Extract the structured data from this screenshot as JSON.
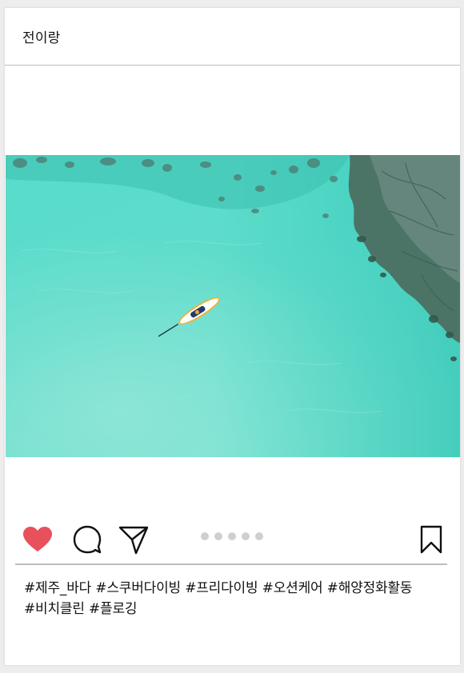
{
  "post": {
    "username": "전이랑",
    "image_alt": "turquoise sea with a paddleboard seen from above",
    "caption_line1": "#제주_바다 #스쿠버다이빙 #프리다이빙 #오션케어 #해양정화활동",
    "caption_line2": "#비치클린 #플로깅",
    "liked": true,
    "carousel": {
      "total": 5
    }
  },
  "icons": {
    "like": "heart-icon",
    "comment": "comment-icon",
    "share": "send-icon",
    "save": "bookmark-icon"
  },
  "colors": {
    "like": "#e8505b",
    "sea": "#4fd8c4",
    "dot": "#cfcfcf"
  }
}
